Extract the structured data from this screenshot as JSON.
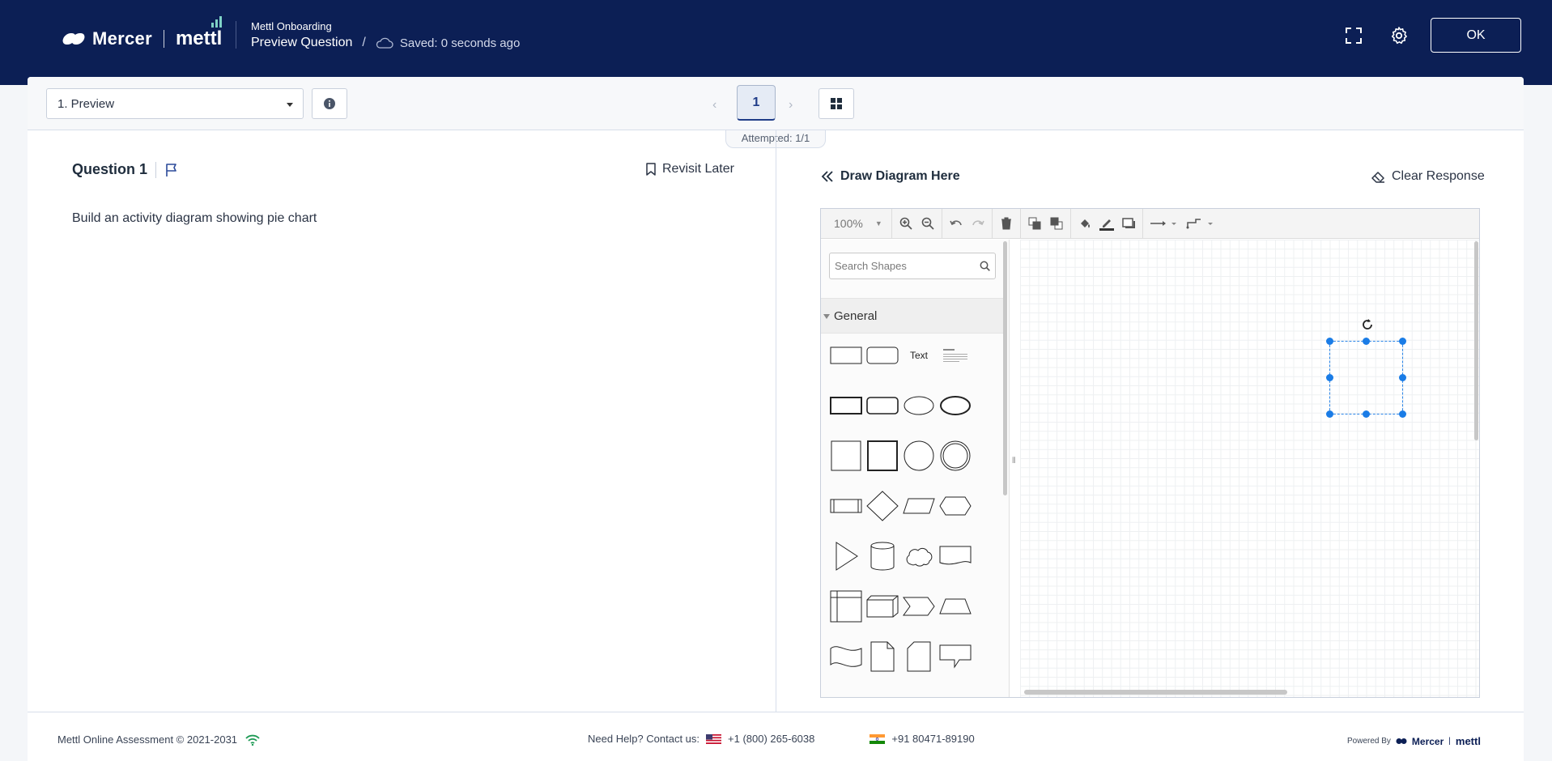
{
  "header": {
    "brand_mercer": "Mercer",
    "brand_mettl": "mettl",
    "subtitle": "Mettl Onboarding",
    "page_title": "Preview Question",
    "save_status": "Saved: 0 seconds ago",
    "ok_label": "OK",
    "bg_color": "#0c1f55"
  },
  "nav": {
    "section_select": "1. Preview",
    "page_number": "1",
    "attempted": "Attempted: 1/1"
  },
  "question": {
    "title": "Question 1",
    "revisit_label": "Revisit Later",
    "text": "Build an activity diagram showing pie chart"
  },
  "diagram": {
    "header": "Draw Diagram Here",
    "clear_label": "Clear Response",
    "zoom": "100%",
    "search_placeholder": "Search Shapes",
    "palette_title": "General",
    "text_shape_label": "Text",
    "selection_color": "#1a7ce6"
  },
  "footer": {
    "copyright": "Mettl Online Assessment © 2021-2031",
    "help_label": "Need Help? Contact us:",
    "phone_us": "+1 (800) 265-6038",
    "phone_in": "+91 80471-89190",
    "powered_by": "Powered By",
    "powered_mercer": "Mercer",
    "powered_mettl": "mettl"
  }
}
